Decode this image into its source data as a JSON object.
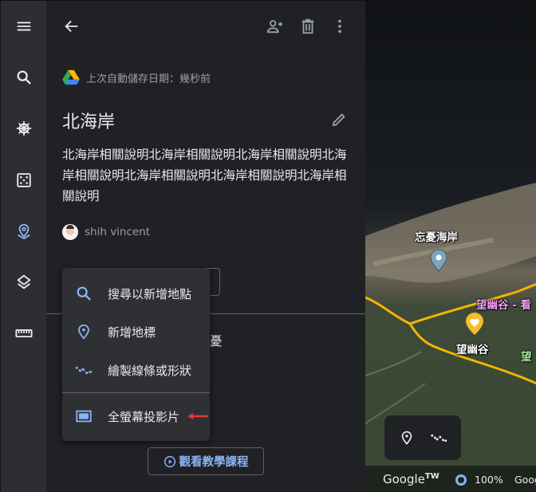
{
  "rail": {
    "items": [
      {
        "name": "menu",
        "icon": "hamburger-menu-icon"
      },
      {
        "name": "search",
        "icon": "search-icon"
      },
      {
        "name": "voyager",
        "icon": "ship-wheel-icon"
      },
      {
        "name": "feeling-lucky",
        "icon": "dice-icon"
      },
      {
        "name": "projects",
        "icon": "projects-pin-icon",
        "active": true
      },
      {
        "name": "map-style",
        "icon": "layers-icon"
      },
      {
        "name": "measure",
        "icon": "ruler-icon"
      }
    ]
  },
  "panel": {
    "back_icon": "arrow-back-icon",
    "actions": [
      "share-person-add-icon",
      "delete-trash-icon",
      "more-vert-icon"
    ],
    "autosave_text": "上次自動儲存日期：幾秒前",
    "title": "北海岸",
    "description": "北海岸相關說明北海岸相關說明北海岸相關說明北海岸相關說明北海岸相關說明北海岸相關說明北海岸相關說明",
    "author": "shih vincent",
    "behind_text": "憂",
    "tutorial_button": "觀看教學課程"
  },
  "menu": {
    "items": [
      {
        "label": "搜尋以新增地點",
        "icon": "search-icon"
      },
      {
        "label": "新增地標",
        "icon": "location-pin-icon"
      },
      {
        "label": "繪製線條或形狀",
        "icon": "draw-line-icon"
      },
      {
        "label": "全螢幕投影片",
        "icon": "fullscreen-slideshow-icon"
      }
    ]
  },
  "map": {
    "labels": {
      "place1": "忘憂海岸",
      "place2": "望幽谷 - 看",
      "place3": "望幽谷",
      "place4": "望"
    },
    "footer": {
      "logo": "Google",
      "logo_suffix": "TW",
      "zoom_level": "100%",
      "attribution": "Goog"
    },
    "colors": {
      "route": "#f4b400",
      "pin_gray": "#7fa3bd",
      "pin_heart": "#f9bb2a",
      "label_pink": "#f49cf4",
      "label_green": "#a8e6a0"
    }
  },
  "colors": {
    "accent": "#8ab4f8",
    "panel_bg": "#202124",
    "rail_bg": "#2d2e31",
    "menu_bg": "#2f3034",
    "arrow_red": "#e53935"
  }
}
